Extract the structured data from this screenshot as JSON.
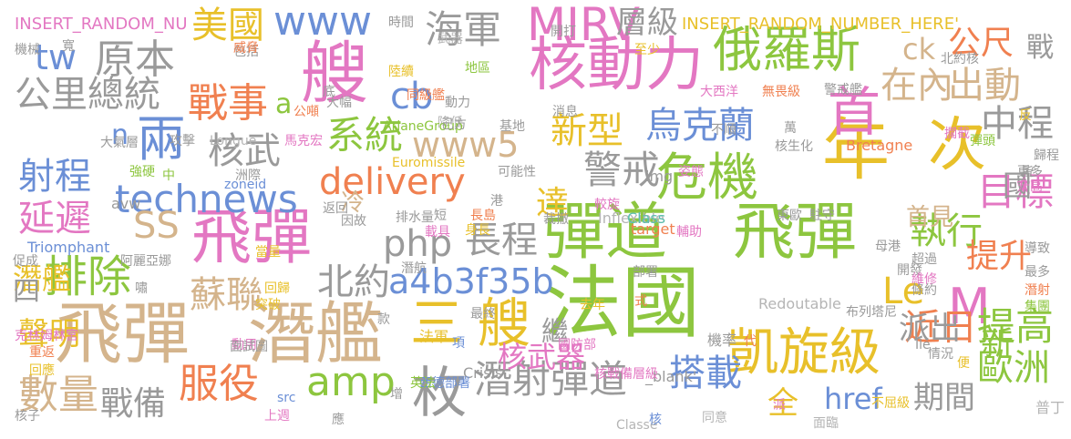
{
  "palette": {
    "green": "#8dc63f",
    "pink": "#e377c2",
    "tan": "#d4b48c",
    "gray": "#9a9a9a",
    "blue": "#6b8fd6",
    "orange": "#f08050",
    "yellow": "#e8c02a",
    "teal": "#5bbfae",
    "lilac": "#b99bd8",
    "lightgray": "#b5b5b5"
  },
  "words": [
    {
      "text": "法國",
      "color": "#8dc63f"
    },
    {
      "text": "飛彈",
      "color": "#d4b48c"
    },
    {
      "text": "潛艦",
      "color": "#d4b48c"
    },
    {
      "text": "彈道",
      "color": "#8dc63f"
    },
    {
      "text": "飛彈",
      "color": "#8dc63f"
    },
    {
      "text": "核動力",
      "color": "#e377c2"
    },
    {
      "text": "年",
      "color": "#e8c02a"
    },
    {
      "text": "次",
      "color": "#e8c02a"
    },
    {
      "text": "艘",
      "color": "#e377c2"
    },
    {
      "text": "飛彈",
      "color": "#e377c2"
    },
    {
      "text": "俄羅斯",
      "color": "#8dc63f"
    },
    {
      "text": "首",
      "color": "#e377c2"
    },
    {
      "text": "危機",
      "color": "#8dc63f"
    },
    {
      "text": "三",
      "color": "#e8c02a"
    },
    {
      "text": "艘",
      "color": "#e8c02a"
    },
    {
      "text": "枚",
      "color": "#9a9a9a"
    },
    {
      "text": "凱旋級",
      "color": "#e8c02a"
    },
    {
      "text": "MIRV",
      "color": "#e377c2"
    },
    {
      "text": "technews",
      "color": "#6b8fd6"
    },
    {
      "text": "delivery",
      "color": "#f08050"
    },
    {
      "text": "排除",
      "color": "#8dc63f"
    },
    {
      "text": "戰事",
      "color": "#f08050"
    },
    {
      "text": "美國",
      "color": "#e8c02a"
    },
    {
      "text": "海軍",
      "color": "#9a9a9a"
    },
    {
      "text": "兩",
      "color": "#6b8fd6"
    },
    {
      "text": "核武",
      "color": "#9a9a9a"
    },
    {
      "text": "系統",
      "color": "#8dc63f"
    },
    {
      "text": "www5",
      "color": "#d4b48c"
    },
    {
      "text": "新型",
      "color": "#e8c02a"
    },
    {
      "text": "警戒",
      "color": "#9a9a9a"
    },
    {
      "text": "烏克蘭",
      "color": "#6b8fd6"
    },
    {
      "text": "中程",
      "color": "#9a9a9a"
    },
    {
      "text": "目標",
      "color": "#e377c2"
    },
    {
      "text": "公尺",
      "color": "#f08050"
    },
    {
      "text": "在內",
      "color": "#d4b48c"
    },
    {
      "text": "出動",
      "color": "#d4b48c"
    },
    {
      "text": "Le",
      "color": "#e8c02a"
    },
    {
      "text": "M",
      "color": "#e377c2"
    },
    {
      "text": "近日",
      "color": "#f08050"
    },
    {
      "text": "提高",
      "color": "#8dc63f"
    },
    {
      "text": "歐洲",
      "color": "#8dc63f"
    },
    {
      "text": "搭載",
      "color": "#6b8fd6"
    },
    {
      "text": "潛射彈道",
      "color": "#9a9a9a"
    },
    {
      "text": "amp",
      "color": "#8dc63f"
    },
    {
      "text": "服役",
      "color": "#f08050"
    },
    {
      "text": "數量",
      "color": "#d4b48c"
    },
    {
      "text": "戰備",
      "color": "#9a9a9a"
    },
    {
      "text": "核武器",
      "color": "#e377c2"
    },
    {
      "text": "www",
      "color": "#6b8fd6"
    },
    {
      "text": "cb",
      "color": "#6b8fd6"
    },
    {
      "text": "原本",
      "color": "#9a9a9a"
    },
    {
      "text": "公里",
      "color": "#9a9a9a"
    },
    {
      "text": "總統",
      "color": "#9a9a9a"
    },
    {
      "text": "tw",
      "color": "#6b8fd6"
    },
    {
      "text": "射程",
      "color": "#6b8fd6"
    },
    {
      "text": "延遲",
      "color": "#e377c2"
    },
    {
      "text": "SS",
      "color": "#d4b48c"
    },
    {
      "text": "php",
      "color": "#9a9a9a"
    },
    {
      "text": "長程",
      "color": "#9a9a9a"
    },
    {
      "text": "北約",
      "color": "#9a9a9a"
    },
    {
      "text": "a4b3f35b",
      "color": "#6b8fd6"
    },
    {
      "text": "蘇聯",
      "color": "#d4b48c"
    },
    {
      "text": "達",
      "color": "#e8c02a"
    },
    {
      "text": "執行",
      "color": "#8dc63f"
    },
    {
      "text": "提升",
      "color": "#f08050"
    },
    {
      "text": "首見",
      "color": "#d4b48c"
    },
    {
      "text": "國",
      "color": "#9a9a9a"
    },
    {
      "text": "派出",
      "color": "#9a9a9a"
    },
    {
      "text": "期間",
      "color": "#9a9a9a"
    },
    {
      "text": "href",
      "color": "#6b8fd6"
    },
    {
      "text": "全",
      "color": "#e8c02a"
    },
    {
      "text": "聲明",
      "color": "#e8c02a"
    },
    {
      "text": "潛艦",
      "color": "#e8c02a"
    },
    {
      "text": "層級",
      "color": "#9a9a9a"
    },
    {
      "text": "ck",
      "color": "#d4b48c"
    },
    {
      "text": "戰",
      "color": "#9a9a9a"
    },
    {
      "text": "新",
      "color": "#8dc63f"
    },
    {
      "text": "INSERT_RANDOM_NU",
      "color": "#e377c2"
    },
    {
      "text": "INSERT_RANDOM_NUMBER_HERE'",
      "color": "#e8c02a"
    },
    {
      "text": "a",
      "color": "#8dc63f"
    },
    {
      "text": "n",
      "color": "#6b8fd6"
    },
    {
      "text": "四",
      "color": "#9a9a9a"
    },
    {
      "text": "冷",
      "color": "#d4b48c"
    },
    {
      "text": "繼",
      "color": "#9a9a9a"
    },
    {
      "text": "時間",
      "color": "#9a9a9a"
    },
    {
      "text": "武器",
      "color": "#b5b5b5"
    },
    {
      "text": "降低",
      "color": "#b5b5b5"
    },
    {
      "text": "至少",
      "color": "#e8c02a"
    },
    {
      "text": "地區",
      "color": "#8dc63f"
    },
    {
      "text": "陸續",
      "color": "#e8c02a"
    },
    {
      "text": "同級艦",
      "color": "#f08050"
    },
    {
      "text": "Longue",
      "color": "#b5b5b5"
    },
    {
      "text": "ArianeGroup",
      "color": "#8dc63f"
    },
    {
      "text": "Euromissile",
      "color": "#e8c02a"
    },
    {
      "text": "zoneid",
      "color": "#6b8fd6"
    },
    {
      "text": "avw",
      "color": "#9a9a9a"
    },
    {
      "text": "Triomphant",
      "color": "#6b8fd6"
    },
    {
      "text": "Inflexible",
      "color": "#b5b5b5"
    },
    {
      "text": "Redoutable",
      "color": "#b5b5b5"
    },
    {
      "text": "Crisis",
      "color": "#9a9a9a"
    },
    {
      "text": "Classe",
      "color": "#b5b5b5"
    },
    {
      "text": "Class",
      "color": "#5bbfae"
    },
    {
      "text": "Bretagne",
      "color": "#f08050"
    },
    {
      "text": "target",
      "color": "#f08050"
    },
    {
      "text": "src",
      "color": "#6b8fd6"
    },
    {
      "text": "img",
      "color": "#9a9a9a"
    },
    {
      "text": "_blank'",
      "color": "#9a9a9a"
    },
    {
      "text": "大西洋",
      "color": "#e377c2"
    },
    {
      "text": "無畏級",
      "color": "#f08050"
    },
    {
      "text": "布列塔尼",
      "color": "#9a9a9a"
    },
    {
      "text": "阿麗亞娜",
      "color": "#9a9a9a"
    },
    {
      "text": "克林姆林宮",
      "color": "#e377c2"
    },
    {
      "text": "西德部署",
      "color": "#6b8fd6"
    },
    {
      "text": "國防部",
      "color": "#e377c2"
    },
    {
      "text": "最終",
      "color": "#9a9a9a"
    },
    {
      "text": "英法",
      "color": "#8dc63f"
    },
    {
      "text": "法軍",
      "color": "#e8c02a"
    },
    {
      "text": "潛航",
      "color": "#9a9a9a"
    },
    {
      "text": "回歸",
      "color": "#e8c02a"
    },
    {
      "text": "突破",
      "color": "#e8c02a"
    },
    {
      "text": "當量",
      "color": "#e8c02a"
    },
    {
      "text": "促成",
      "color": "#9a9a9a"
    },
    {
      "text": "重返",
      "color": "#f08050"
    },
    {
      "text": "回應",
      "color": "#e8c02a"
    },
    {
      "text": "核子",
      "color": "#9a9a9a"
    },
    {
      "text": "上週",
      "color": "#e377c2"
    },
    {
      "text": "應",
      "color": "#9a9a9a"
    },
    {
      "text": "核",
      "color": "#6b8fd6"
    },
    {
      "text": "核戰備層級",
      "color": "#e377c2"
    },
    {
      "text": "機率",
      "color": "#9a9a9a"
    },
    {
      "text": "同意",
      "color": "#b5b5b5"
    },
    {
      "text": "面臨",
      "color": "#b5b5b5"
    },
    {
      "text": "派",
      "color": "#e377c2"
    },
    {
      "text": "不屈級",
      "color": "#e8c02a"
    },
    {
      "text": "普丁",
      "color": "#b5b5b5"
    },
    {
      "text": "Ile",
      "color": "#9a9a9a"
    },
    {
      "text": "開發",
      "color": "#9a9a9a"
    },
    {
      "text": "超過",
      "color": "#9a9a9a"
    },
    {
      "text": "維修",
      "color": "#e377c2"
    },
    {
      "text": "條約",
      "color": "#9a9a9a"
    },
    {
      "text": "最多",
      "color": "#9a9a9a"
    },
    {
      "text": "潛射",
      "color": "#f08050"
    },
    {
      "text": "集團",
      "color": "#8dc63f"
    },
    {
      "text": "導致",
      "color": "#9a9a9a"
    },
    {
      "text": "歸程",
      "color": "#9a9a9a"
    },
    {
      "text": "升高",
      "color": "#e377c2"
    },
    {
      "text": "更多",
      "color": "#9a9a9a"
    },
    {
      "text": "皆",
      "color": "#9a9a9a"
    },
    {
      "text": "反",
      "color": "#e8c02a"
    },
    {
      "text": "彈頭",
      "color": "#8dc63f"
    },
    {
      "text": "擱截",
      "color": "#e377c2"
    },
    {
      "text": "北約核",
      "color": "#9a9a9a"
    },
    {
      "text": "警戒艦",
      "color": "#9a9a9a"
    },
    {
      "text": "萬",
      "color": "#9a9a9a"
    },
    {
      "text": "不順",
      "color": "#9a9a9a"
    },
    {
      "text": "核生化",
      "color": "#9a9a9a"
    },
    {
      "text": "姿態",
      "color": "#e377c2"
    },
    {
      "text": "駐守",
      "color": "#9a9a9a"
    },
    {
      "text": "東歐",
      "color": "#9a9a9a"
    },
    {
      "text": "較旋",
      "color": "#e377c2"
    },
    {
      "text": "部署",
      "color": "#9a9a9a"
    },
    {
      "text": "輔助",
      "color": "#e377c2"
    },
    {
      "text": "母港",
      "color": "#9a9a9a"
    },
    {
      "text": "式",
      "color": "#f08050"
    },
    {
      "text": "去年",
      "color": "#e8c02a"
    },
    {
      "text": "代",
      "color": "#f08050"
    },
    {
      "text": "情況",
      "color": "#9a9a9a"
    },
    {
      "text": "便",
      "color": "#e8c02a"
    },
    {
      "text": "增",
      "color": "#9a9a9a"
    },
    {
      "text": "項",
      "color": "#6b8fd6"
    },
    {
      "text": "款",
      "color": "#9a9a9a"
    },
    {
      "text": "動用",
      "color": "#e377c2"
    },
    {
      "text": "面試圖",
      "color": "#9a9a9a"
    },
    {
      "text": "嘯",
      "color": "#9a9a9a"
    },
    {
      "text": "洲際",
      "color": "#9a9a9a"
    },
    {
      "text": "中",
      "color": "#8dc63f"
    },
    {
      "text": "強硬",
      "color": "#8dc63f"
    },
    {
      "text": "大氣層",
      "color": "#9a9a9a"
    },
    {
      "text": "攻擊",
      "color": "#9a9a9a"
    },
    {
      "text": "馬克宏",
      "color": "#e377c2"
    },
    {
      "text": "己方",
      "color": "#9a9a9a"
    },
    {
      "text": "動力",
      "color": "#9a9a9a"
    },
    {
      "text": "基地",
      "color": "#9a9a9a"
    },
    {
      "text": "消息",
      "color": "#9a9a9a"
    },
    {
      "text": "公噸",
      "color": "#f08050"
    },
    {
      "text": "底",
      "color": "#9a9a9a"
    },
    {
      "text": "大幅",
      "color": "#9a9a9a"
    },
    {
      "text": "包括",
      "color": "#9a9a9a"
    },
    {
      "text": "威脅",
      "color": "#f08050"
    },
    {
      "text": "寬",
      "color": "#9a9a9a"
    },
    {
      "text": "機械",
      "color": "#9a9a9a"
    },
    {
      "text": "可能性",
      "color": "#9a9a9a"
    },
    {
      "text": "排水量",
      "color": "#9a9a9a"
    },
    {
      "text": "短",
      "color": "#9a9a9a"
    },
    {
      "text": "載具",
      "color": "#e377c2"
    },
    {
      "text": "長島",
      "color": "#f08050"
    },
    {
      "text": "身長",
      "color": "#e8c02a"
    },
    {
      "text": "港",
      "color": "#9a9a9a"
    },
    {
      "text": "返回",
      "color": "#9a9a9a"
    },
    {
      "text": "因故",
      "color": "#9a9a9a"
    },
    {
      "text": "裁撤",
      "color": "#9a9a9a"
    },
    {
      "text": "開打",
      "color": "#9a9a9a"
    },
    {
      "text": "艦",
      "color": "#e8c02a"
    },
    {
      "text": "≈",
      "color": "#9a9a9a"
    }
  ]
}
